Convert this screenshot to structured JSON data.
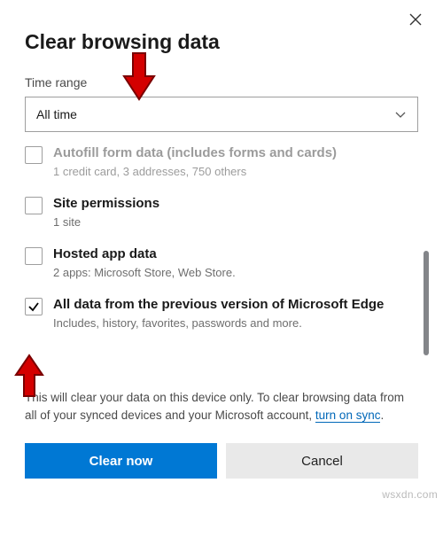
{
  "dialog": {
    "title": "Clear browsing data",
    "time_range_label": "Time range"
  },
  "select": {
    "value": "All time"
  },
  "items": [
    {
      "checked": false,
      "label": "Autofill form data (includes forms and cards)",
      "sub": "1 credit card, 3 addresses, 750 others",
      "cutoff": true
    },
    {
      "checked": false,
      "label": "Site permissions",
      "sub": "1 site",
      "cutoff": false
    },
    {
      "checked": false,
      "label": "Hosted app data",
      "sub": "2 apps: Microsoft Store, Web Store.",
      "cutoff": false
    },
    {
      "checked": true,
      "label": "All data from the previous version of Microsoft Edge",
      "sub": "Includes, history, favorites, passwords and more.",
      "cutoff": false
    }
  ],
  "footer": {
    "note_pre": "This will clear your data on this device only. To clear browsing data from all of your synced devices and your Microsoft account, ",
    "link": "turn on sync",
    "note_post": "."
  },
  "buttons": {
    "primary": "Clear now",
    "secondary": "Cancel"
  },
  "watermark": "wsxdn.com"
}
